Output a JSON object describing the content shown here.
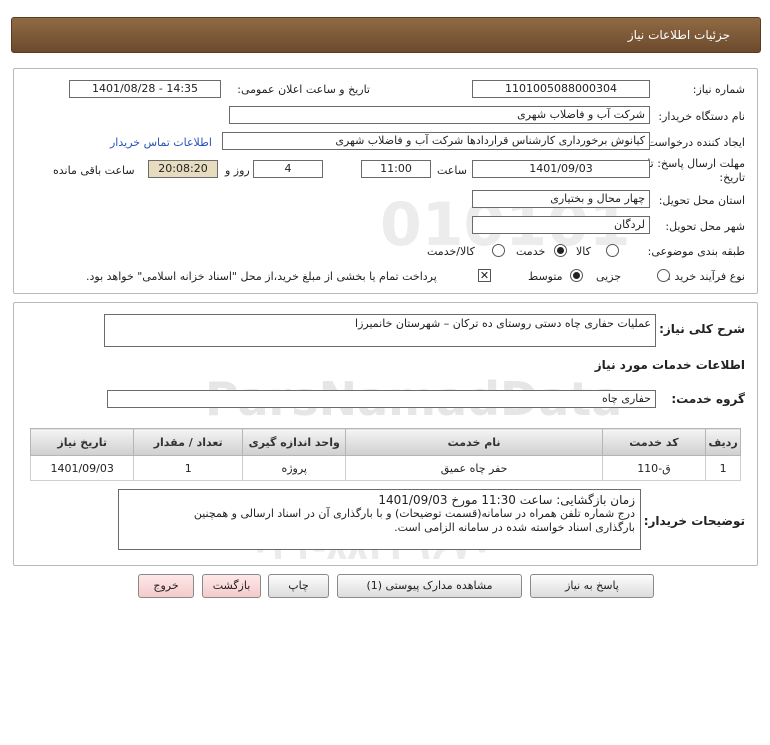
{
  "header": {
    "title": "جزئیات اطلاعات نیاز"
  },
  "form": {
    "need_number_label": "شماره نیاز:",
    "need_number": "1101005088000304",
    "announce_label": "تاریخ و ساعت اعلان عمومی:",
    "announce_value": "1401/08/28 - 14:35",
    "buyer_label": "نام دستگاه خریدار:",
    "buyer_value": "شرکت آب و فاضلاب شهری",
    "requester_label": "ایجاد کننده درخواست:",
    "requester_value": "کیانوش برخورداری کارشناس قراردادها شرکت آب و فاضلاب شهری",
    "contact_link": "اطلاعات تماس خریدار",
    "deadline_label_1": "مهلت ارسال پاسخ: تا",
    "deadline_label_2": "تاریخ:",
    "deadline_date": "1401/09/03",
    "time_label": "ساعت",
    "deadline_time": "11:00",
    "days_value": "4",
    "days_label": "روز و",
    "remaining_value": "20:08:20",
    "remaining_label": "ساعت باقی مانده",
    "province_label": "استان محل تحویل:",
    "province_value": "چهار محال و بختیاری",
    "city_label": "شهر محل تحویل:",
    "city_value": "لردگان",
    "category_label": "طبقه بندی موضوعی:",
    "category_options": [
      "کالا",
      "خدمت",
      "کالا/خدمت"
    ],
    "category_selected": "خدمت",
    "process_label": "نوع فرآیند خرید :",
    "process_options": [
      "جزیی",
      "متوسط"
    ],
    "process_selected": "متوسط",
    "payment_note": "پرداخت تمام یا بخشی از مبلغ خرید،از محل \"اسناد خزانه اسلامی\" خواهد بود.",
    "payment_checked": true
  },
  "description": {
    "label": "شرح کلی نیاز:",
    "value": "عملیات حفاری چاه دستی روستای ده ترکان – شهرستان خانمیرزا",
    "services_title": "اطلاعات خدمات مورد نیاز",
    "group_label": "گروه خدمت:",
    "group_value": "حفاری چاه"
  },
  "table": {
    "headers": [
      "ردیف",
      "کد خدمت",
      "نام خدمت",
      "واحد اندازه گیری",
      "تعداد / مقدار",
      "تاریخ نیاز"
    ],
    "rows": [
      [
        "1",
        "ق-110",
        "حفر چاه عمیق",
        "پروژه",
        "1",
        "1401/09/03"
      ]
    ]
  },
  "buyer_notes": {
    "label": "توضیحات خریدار:",
    "line1": "زمان بازگشایی: ساعت 11:30 مورخ 1401/09/03",
    "line2": "درج شماره تلفن همراه در سامانه(قسمت توضیحات) و با بارگذاری آن در اسناد ارسالی و همچنین",
    "line3": "بارگذاری اسناد خواسته شده در سامانه الزامی است."
  },
  "buttons": {
    "reply": "پاسخ به نیاز",
    "attachments": "مشاهده مدارک پیوستی (1)",
    "print": "چاپ",
    "back": "بازگشت",
    "exit": "خروج"
  },
  "watermark": {
    "brand": "ParsNamadData",
    "line_a": "مرکز فراوری اطلاعات پارس نماد داده",
    "line_b": "پایگاه اطلاع رسانی مناقصه و مزایده",
    "phone": "۰۲۱-۸۸۳۴۹۶۷۰",
    "code": "010101"
  }
}
